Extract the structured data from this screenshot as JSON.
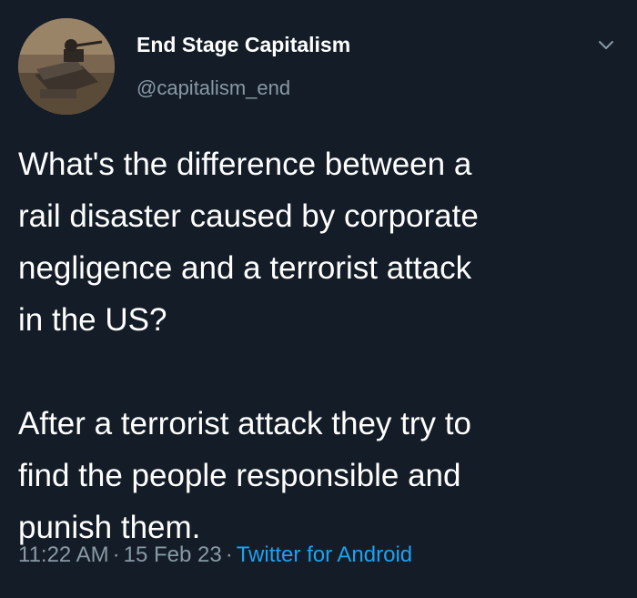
{
  "tweet": {
    "display_name": "End Stage Capitalism",
    "handle": "@capitalism_end",
    "paragraphs": [
      "What's the difference between a\nrail disaster caused by corporate\nnegligence and a terrorist attack\nin the US?",
      "After a terrorist attack they try to\nfind the people responsible and\npunish them."
    ],
    "time": "11:22 AM",
    "date": "15 Feb 23",
    "separator": "·",
    "source": "Twitter for Android"
  },
  "icons": {
    "menu": "chevron-down-icon",
    "avatar": "avatar-image"
  },
  "colors": {
    "background": "#141d27",
    "text": "#ffffff",
    "secondary": "#8899a6",
    "link": "#1da1f2"
  }
}
